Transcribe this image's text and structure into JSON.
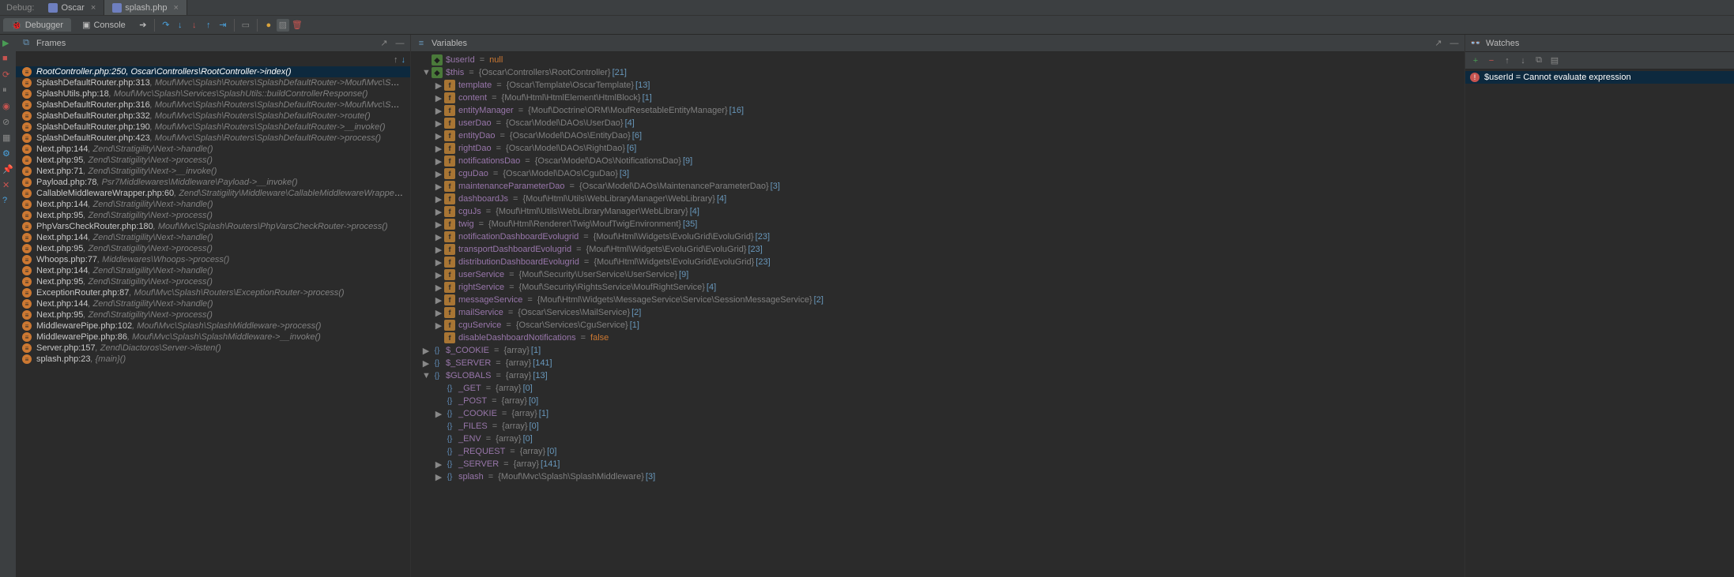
{
  "top": {
    "debug_label": "Debug:",
    "tabs": [
      {
        "label": "Oscar",
        "active": false
      },
      {
        "label": "splash.php",
        "active": true
      }
    ]
  },
  "toolbar": {
    "tabs": [
      {
        "label": "Debugger",
        "active": true
      },
      {
        "label": "Console",
        "active": false
      }
    ]
  },
  "panels": {
    "frames_title": "Frames",
    "variables_title": "Variables",
    "watches_title": "Watches"
  },
  "gutter_icons": [
    "resume",
    "stop",
    "stop-restart",
    "pause",
    "view-breakpoints",
    "mute-breakpoints",
    "settings",
    "pin",
    "close",
    "help"
  ],
  "frames": [
    {
      "loc": "RootController.php:250",
      "fn": "Oscar\\Controllers\\RootController->index()",
      "selected": true
    },
    {
      "loc": "SplashDefaultRouter.php:313",
      "fn": "Mouf\\Mvc\\Splash\\Routers\\SplashDefaultRouter->Mouf\\Mvc\\Splash\\Routers\\{closure}()"
    },
    {
      "loc": "SplashUtils.php:18",
      "fn": "Mouf\\Mvc\\Splash\\Services\\SplashUtils::buildControllerResponse()"
    },
    {
      "loc": "SplashDefaultRouter.php:316",
      "fn": "Mouf\\Mvc\\Splash\\Routers\\SplashDefaultRouter->Mouf\\Mvc\\Splash\\Routers\\{closure}()"
    },
    {
      "loc": "SplashDefaultRouter.php:332",
      "fn": "Mouf\\Mvc\\Splash\\Routers\\SplashDefaultRouter->route()"
    },
    {
      "loc": "SplashDefaultRouter.php:190",
      "fn": "Mouf\\Mvc\\Splash\\Routers\\SplashDefaultRouter->__invoke()"
    },
    {
      "loc": "SplashDefaultRouter.php:423",
      "fn": "Mouf\\Mvc\\Splash\\Routers\\SplashDefaultRouter->process()"
    },
    {
      "loc": "Next.php:144",
      "fn": "Zend\\Stratigility\\Next->handle()"
    },
    {
      "loc": "Next.php:95",
      "fn": "Zend\\Stratigility\\Next->process()"
    },
    {
      "loc": "Next.php:71",
      "fn": "Zend\\Stratigility\\Next->__invoke()"
    },
    {
      "loc": "Payload.php:78",
      "fn": "Psr7Middlewares\\Middleware\\Payload->__invoke()"
    },
    {
      "loc": "CallableMiddlewareWrapper.php:60",
      "fn": "Zend\\Stratigility\\Middleware\\CallableMiddlewareWrapper->process()"
    },
    {
      "loc": "Next.php:144",
      "fn": "Zend\\Stratigility\\Next->handle()"
    },
    {
      "loc": "Next.php:95",
      "fn": "Zend\\Stratigility\\Next->process()"
    },
    {
      "loc": "PhpVarsCheckRouter.php:180",
      "fn": "Mouf\\Mvc\\Splash\\Routers\\PhpVarsCheckRouter->process()"
    },
    {
      "loc": "Next.php:144",
      "fn": "Zend\\Stratigility\\Next->handle()"
    },
    {
      "loc": "Next.php:95",
      "fn": "Zend\\Stratigility\\Next->process()"
    },
    {
      "loc": "Whoops.php:77",
      "fn": "Middlewares\\Whoops->process()"
    },
    {
      "loc": "Next.php:144",
      "fn": "Zend\\Stratigility\\Next->handle()"
    },
    {
      "loc": "Next.php:95",
      "fn": "Zend\\Stratigility\\Next->process()"
    },
    {
      "loc": "ExceptionRouter.php:87",
      "fn": "Mouf\\Mvc\\Splash\\Routers\\ExceptionRouter->process()"
    },
    {
      "loc": "Next.php:144",
      "fn": "Zend\\Stratigility\\Next->handle()"
    },
    {
      "loc": "Next.php:95",
      "fn": "Zend\\Stratigility\\Next->process()"
    },
    {
      "loc": "MiddlewarePipe.php:102",
      "fn": "Mouf\\Mvc\\Splash\\SplashMiddleware->process()"
    },
    {
      "loc": "MiddlewarePipe.php:86",
      "fn": "Mouf\\Mvc\\Splash\\SplashMiddleware->__invoke()"
    },
    {
      "loc": "Server.php:157",
      "fn": "Zend\\Diactoros\\Server->listen()"
    },
    {
      "loc": "splash.php:23",
      "fn": "{main}()"
    }
  ],
  "variables": [
    {
      "depth": 0,
      "tw": "",
      "kind": "global",
      "name": "$userId",
      "val_type": "",
      "val": "null",
      "valclass": "val-null"
    },
    {
      "depth": 0,
      "tw": "▼",
      "kind": "global",
      "name": "$this",
      "val_type": "{Oscar\\Controllers\\RootController}",
      "val": "[21]"
    },
    {
      "depth": 1,
      "tw": "▶",
      "kind": "field",
      "name": "template",
      "val_type": "{Oscar\\Template\\OscarTemplate}",
      "val": "[13]"
    },
    {
      "depth": 1,
      "tw": "▶",
      "kind": "field",
      "name": "content",
      "val_type": "{Mouf\\Html\\HtmlElement\\HtmlBlock}",
      "val": "[1]"
    },
    {
      "depth": 1,
      "tw": "▶",
      "kind": "field",
      "name": "entityManager",
      "val_type": "{Mouf\\Doctrine\\ORM\\MoufResetableEntityManager}",
      "val": "[16]"
    },
    {
      "depth": 1,
      "tw": "▶",
      "kind": "field",
      "name": "userDao",
      "val_type": "{Oscar\\Model\\DAOs\\UserDao}",
      "val": "[4]"
    },
    {
      "depth": 1,
      "tw": "▶",
      "kind": "field",
      "name": "entityDao",
      "val_type": "{Oscar\\Model\\DAOs\\EntityDao}",
      "val": "[6]"
    },
    {
      "depth": 1,
      "tw": "▶",
      "kind": "field",
      "name": "rightDao",
      "val_type": "{Oscar\\Model\\DAOs\\RightDao}",
      "val": "[6]"
    },
    {
      "depth": 1,
      "tw": "▶",
      "kind": "field",
      "name": "notificationsDao",
      "val_type": "{Oscar\\Model\\DAOs\\NotificationsDao}",
      "val": "[9]"
    },
    {
      "depth": 1,
      "tw": "▶",
      "kind": "field",
      "name": "cguDao",
      "val_type": "{Oscar\\Model\\DAOs\\CguDao}",
      "val": "[3]"
    },
    {
      "depth": 1,
      "tw": "▶",
      "kind": "field",
      "name": "maintenanceParameterDao",
      "val_type": "{Oscar\\Model\\DAOs\\MaintenanceParameterDao}",
      "val": "[3]"
    },
    {
      "depth": 1,
      "tw": "▶",
      "kind": "field",
      "name": "dashboardJs",
      "val_type": "{Mouf\\Html\\Utils\\WebLibraryManager\\WebLibrary}",
      "val": "[4]"
    },
    {
      "depth": 1,
      "tw": "▶",
      "kind": "field",
      "name": "cguJs",
      "val_type": "{Mouf\\Html\\Utils\\WebLibraryManager\\WebLibrary}",
      "val": "[4]"
    },
    {
      "depth": 1,
      "tw": "▶",
      "kind": "field",
      "name": "twig",
      "val_type": "{Mouf\\Html\\Renderer\\Twig\\MoufTwigEnvironment}",
      "val": "[35]"
    },
    {
      "depth": 1,
      "tw": "▶",
      "kind": "field",
      "name": "notificationDashboardEvolugrid",
      "val_type": "{Mouf\\Html\\Widgets\\EvoluGrid\\EvoluGrid}",
      "val": "[23]"
    },
    {
      "depth": 1,
      "tw": "▶",
      "kind": "field",
      "name": "transportDashboardEvolugrid",
      "val_type": "{Mouf\\Html\\Widgets\\EvoluGrid\\EvoluGrid}",
      "val": "[23]"
    },
    {
      "depth": 1,
      "tw": "▶",
      "kind": "field",
      "name": "distributionDashboardEvolugrid",
      "val_type": "{Mouf\\Html\\Widgets\\EvoluGrid\\EvoluGrid}",
      "val": "[23]"
    },
    {
      "depth": 1,
      "tw": "▶",
      "kind": "field",
      "name": "userService",
      "val_type": "{Mouf\\Security\\UserService\\UserService}",
      "val": "[9]"
    },
    {
      "depth": 1,
      "tw": "▶",
      "kind": "field",
      "name": "rightService",
      "val_type": "{Mouf\\Security\\RightsService\\MoufRightService}",
      "val": "[4]"
    },
    {
      "depth": 1,
      "tw": "▶",
      "kind": "field",
      "name": "messageService",
      "val_type": "{Mouf\\Html\\Widgets\\MessageService\\Service\\SessionMessageService}",
      "val": "[2]"
    },
    {
      "depth": 1,
      "tw": "▶",
      "kind": "field",
      "name": "mailService",
      "val_type": "{Oscar\\Services\\MailService}",
      "val": "[2]"
    },
    {
      "depth": 1,
      "tw": "▶",
      "kind": "field",
      "name": "cguService",
      "val_type": "{Oscar\\Services\\CguService}",
      "val": "[1]"
    },
    {
      "depth": 1,
      "tw": "",
      "kind": "field",
      "name": "disableDashboardNotifications",
      "val_type": "",
      "val": "false",
      "valclass": "val-bool"
    },
    {
      "depth": 0,
      "tw": "▶",
      "kind": "arr",
      "name": "$_COOKIE",
      "val_type": "{array}",
      "val": "[1]"
    },
    {
      "depth": 0,
      "tw": "▶",
      "kind": "arr",
      "name": "$_SERVER",
      "val_type": "{array}",
      "val": "[141]"
    },
    {
      "depth": 0,
      "tw": "▼",
      "kind": "arr",
      "name": "$GLOBALS",
      "val_type": "{array}",
      "val": "[13]"
    },
    {
      "depth": 1,
      "tw": "",
      "kind": "arr",
      "name": "_GET",
      "val_type": "{array}",
      "val": "[0]"
    },
    {
      "depth": 1,
      "tw": "",
      "kind": "arr",
      "name": "_POST",
      "val_type": "{array}",
      "val": "[0]"
    },
    {
      "depth": 1,
      "tw": "▶",
      "kind": "arr",
      "name": "_COOKIE",
      "val_type": "{array}",
      "val": "[1]"
    },
    {
      "depth": 1,
      "tw": "",
      "kind": "arr",
      "name": "_FILES",
      "val_type": "{array}",
      "val": "[0]"
    },
    {
      "depth": 1,
      "tw": "",
      "kind": "arr",
      "name": "_ENV",
      "val_type": "{array}",
      "val": "[0]"
    },
    {
      "depth": 1,
      "tw": "",
      "kind": "arr",
      "name": "_REQUEST",
      "val_type": "{array}",
      "val": "[0]"
    },
    {
      "depth": 1,
      "tw": "▶",
      "kind": "arr",
      "name": "_SERVER",
      "val_type": "{array}",
      "val": "[141]"
    },
    {
      "depth": 1,
      "tw": "▶",
      "kind": "arr",
      "name": "splash",
      "val_type": "{Mouf\\Mvc\\Splash\\SplashMiddleware}",
      "val": "[3]"
    }
  ],
  "watches": [
    {
      "expr": "$userId",
      "result": "Cannot evaluate expression"
    }
  ]
}
